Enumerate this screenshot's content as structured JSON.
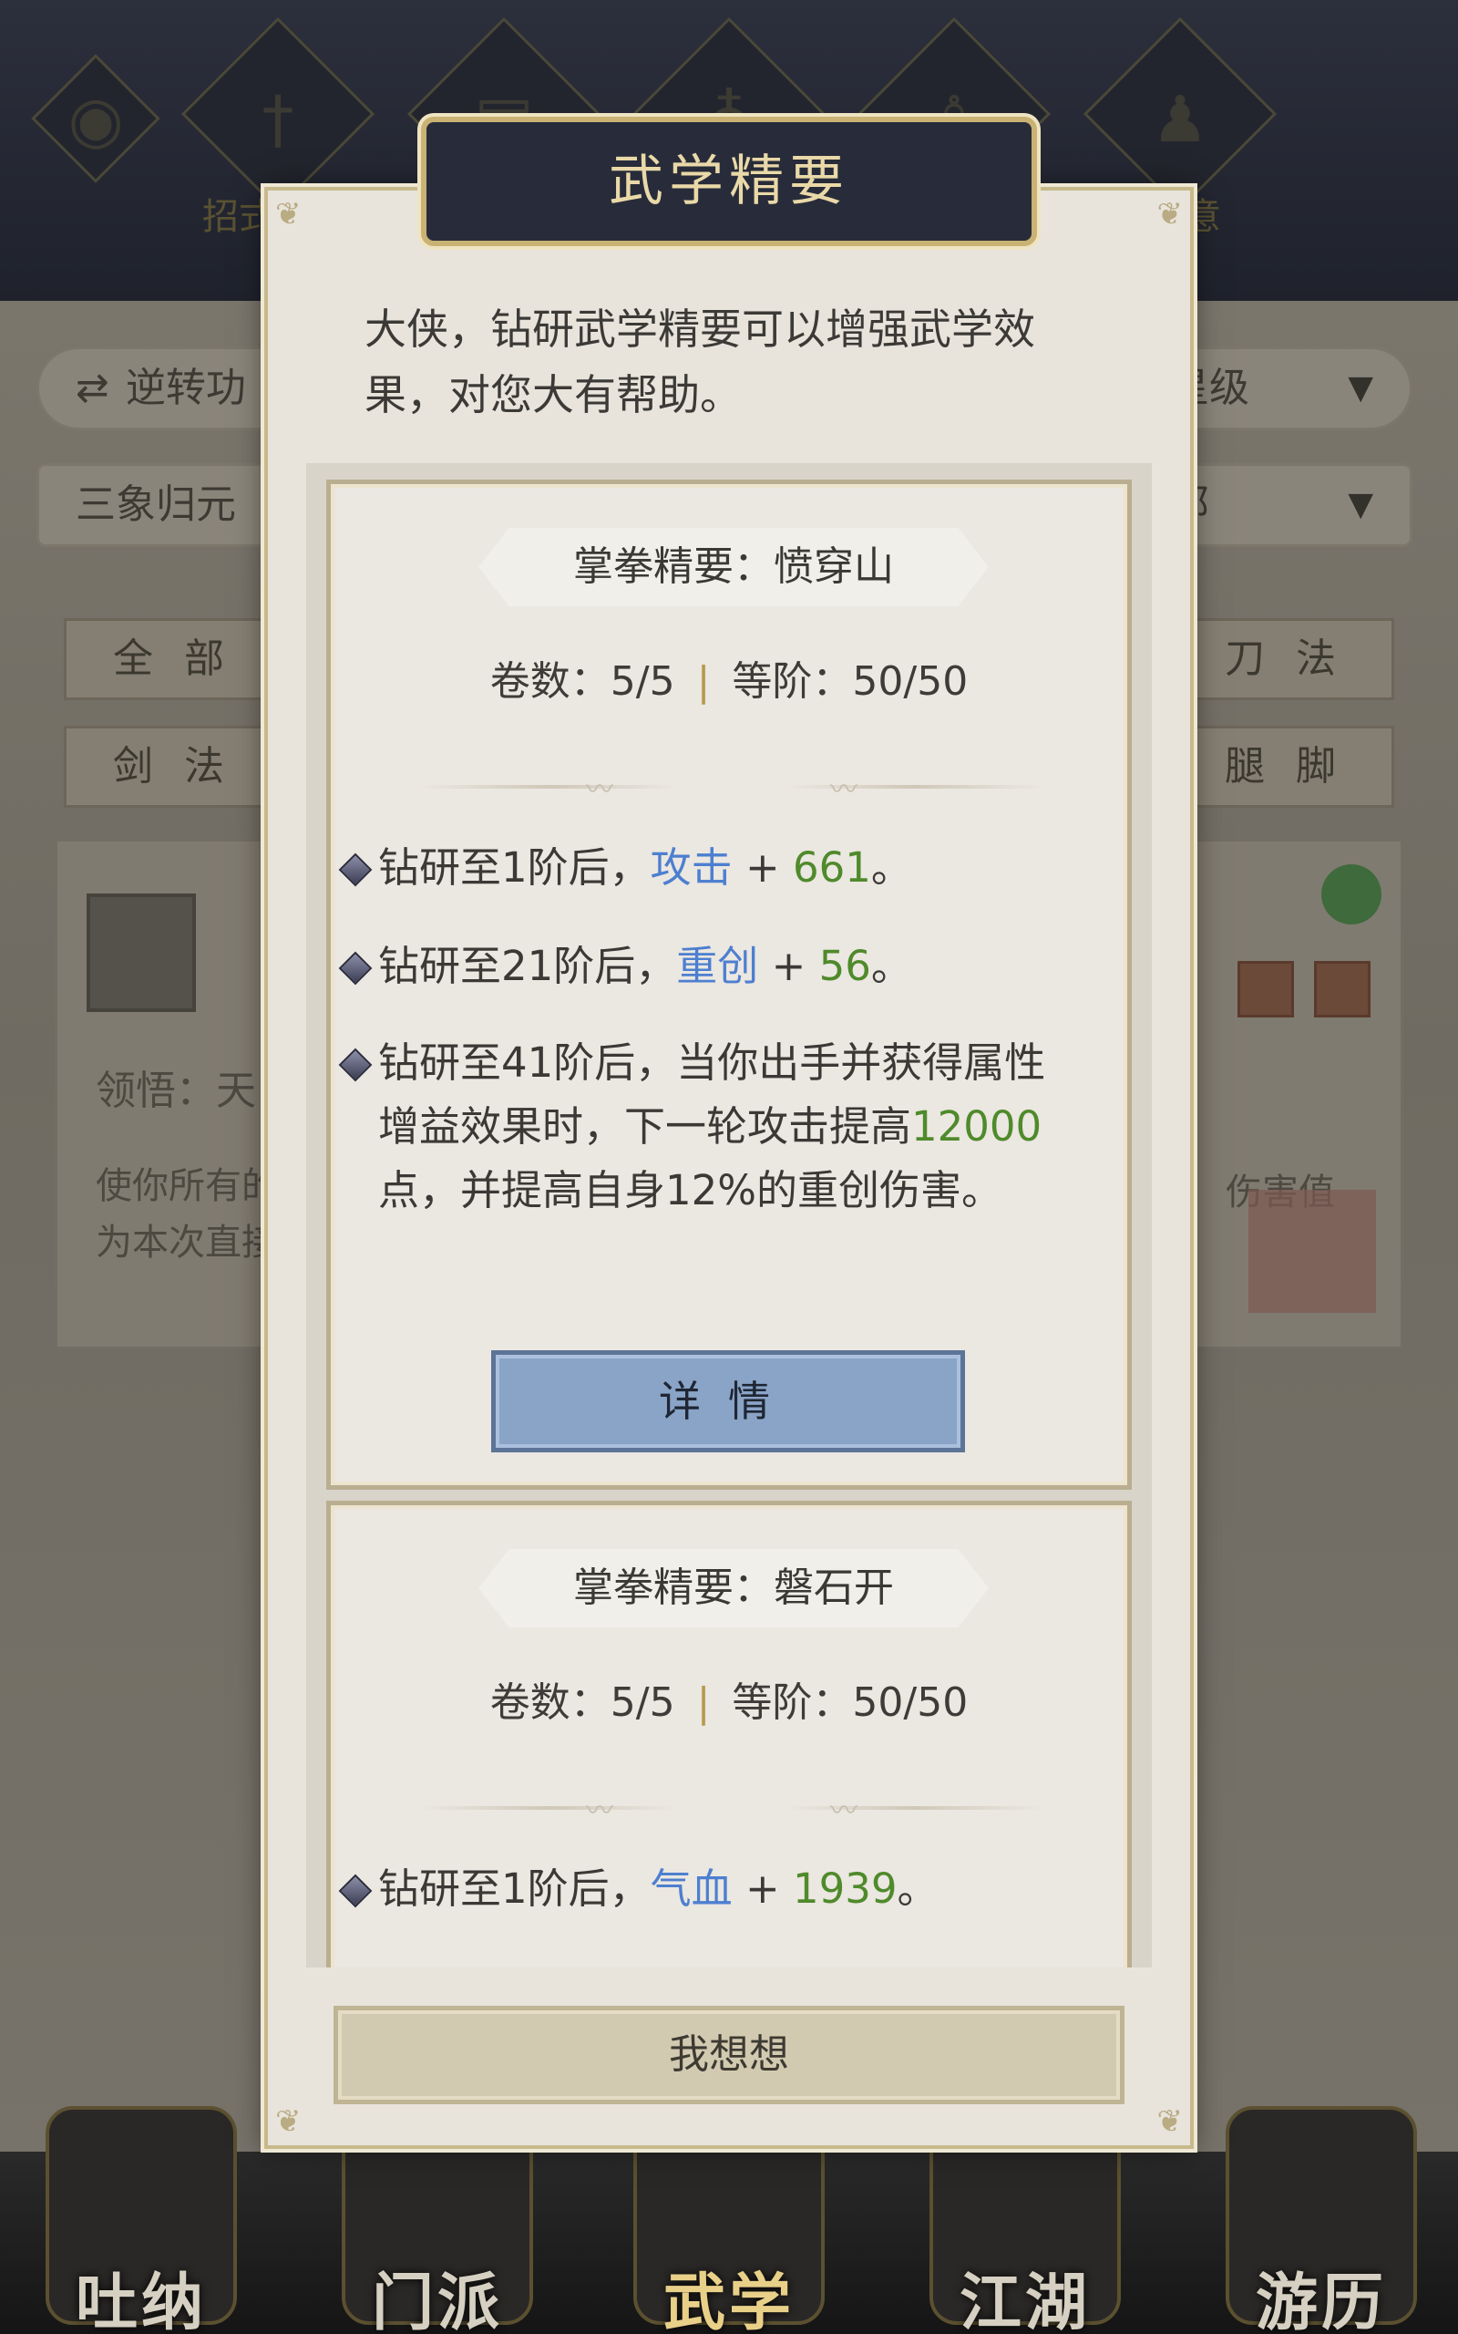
{
  "background": {
    "top_tabs": [
      {
        "label": "招式",
        "icon": "eye-icon"
      },
      {
        "label": "",
        "icon": "sword-icon"
      },
      {
        "label": "",
        "icon": "book-icon"
      },
      {
        "label": "",
        "icon": "bag-icon"
      },
      {
        "label": "",
        "icon": "figure-icon"
      },
      {
        "label": "意",
        "icon": "stance-icon"
      }
    ],
    "reverse_button": "逆转功",
    "star_filter": "星级",
    "skill_select": "三象归元",
    "all_select": "部",
    "tags": [
      "全 部",
      "刀 法",
      "剑 法",
      "腿 脚"
    ],
    "comprehend_label": "领悟：天",
    "desc_left": "使你所有的\n为本次直接",
    "desc_right": "伤害值",
    "bottom_nav": [
      "吐纳",
      "门派",
      "武学",
      "江湖",
      "游历"
    ]
  },
  "modal": {
    "title": "武学精要",
    "intro": "大侠，钻研武学精要可以增强武学效果，对您大有帮助。",
    "sections": [
      {
        "title": "掌拳精要：愤穿山",
        "volumes_label": "卷数：",
        "volumes": "5/5",
        "rank_label": "等阶：",
        "rank": "50/50",
        "bullet1_pre": "钻研至1阶后，",
        "bullet1_stat": "攻击",
        "bullet1_plus": " + ",
        "bullet1_val": "661",
        "bullet1_end": "。",
        "bullet2_pre": "钻研至21阶后，",
        "bullet2_stat": "重创",
        "bullet2_plus": " + ",
        "bullet2_val": "56",
        "bullet2_end": "。",
        "bullet3_pre": "钻研至41阶后，当你出手并获得属性增益效果时，下一轮攻击提高",
        "bullet3_val": "12000",
        "bullet3_end": "点，并提高自身12%的重创伤害。",
        "detail_button": "详情"
      },
      {
        "title": "掌拳精要：磐石开",
        "volumes_label": "卷数：",
        "volumes": "5/5",
        "rank_label": "等阶：",
        "rank": "50/50",
        "bullet1_pre": "钻研至1阶后，",
        "bullet1_stat": "气血",
        "bullet1_plus": " + ",
        "bullet1_val": "1939",
        "bullet1_end": "。"
      }
    ],
    "think_button": "我想想"
  },
  "colors": {
    "stat_blue": "#4d7fd0",
    "value_green": "#4f8a2b",
    "detail_button": "#8aa4c8",
    "title_box": "#282c3a"
  }
}
